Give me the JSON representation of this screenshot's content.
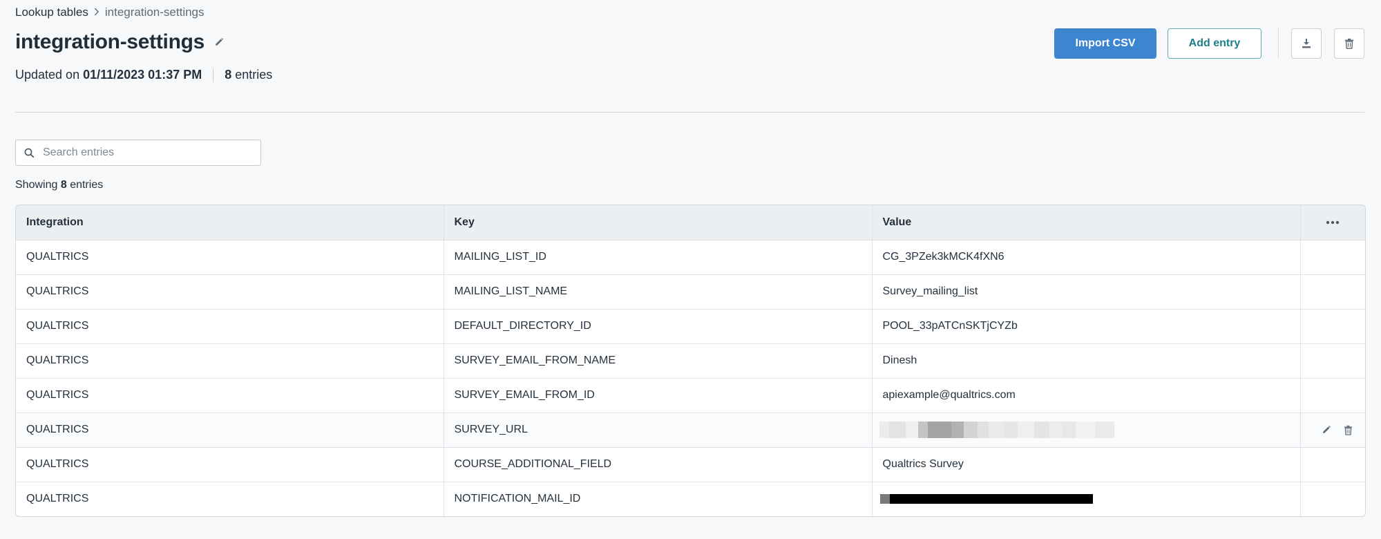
{
  "breadcrumb": {
    "parent": "Lookup tables",
    "current": "integration-settings"
  },
  "title": "integration-settings",
  "meta": {
    "updated_prefix": "Updated on",
    "updated_date": "01/11/2023 01:37 PM",
    "entry_count": "8",
    "entry_label": "entries"
  },
  "actions": {
    "import_csv": "Import CSV",
    "add_entry": "Add entry"
  },
  "search": {
    "placeholder": "Search entries",
    "value": ""
  },
  "showing": {
    "prefix": "Showing",
    "count": "8",
    "suffix": "entries"
  },
  "table": {
    "columns": [
      "Integration",
      "Key",
      "Value"
    ],
    "rows": [
      {
        "integration": "QUALTRICS",
        "key": "MAILING_LIST_ID",
        "value": "CG_3PZek3kMCK4fXN6"
      },
      {
        "integration": "QUALTRICS",
        "key": "MAILING_LIST_NAME",
        "value": "Survey_mailing_list"
      },
      {
        "integration": "QUALTRICS",
        "key": "DEFAULT_DIRECTORY_ID",
        "value": "POOL_33pATCnSKTjCYZb"
      },
      {
        "integration": "QUALTRICS",
        "key": "SURVEY_EMAIL_FROM_NAME",
        "value": "Dinesh"
      },
      {
        "integration": "QUALTRICS",
        "key": "SURVEY_EMAIL_FROM_ID",
        "value": "apiexample@qualtrics.com"
      },
      {
        "integration": "QUALTRICS",
        "key": "SURVEY_URL",
        "value": ""
      },
      {
        "integration": "QUALTRICS",
        "key": "COURSE_ADDITIONAL_FIELD",
        "value": "Qualtrics Survey"
      },
      {
        "integration": "QUALTRICS",
        "key": "NOTIFICATION_MAIL_ID",
        "value": ""
      }
    ]
  },
  "colors": {
    "primary": "#3d85cf",
    "accent": "#1a7f86",
    "header_bg": "#eceff2",
    "page_bg": "#f7f8fa"
  },
  "icons": [
    "chevron-right-icon",
    "pencil-icon",
    "download-icon",
    "trash-icon",
    "search-icon",
    "more-horizontal-icon"
  ]
}
